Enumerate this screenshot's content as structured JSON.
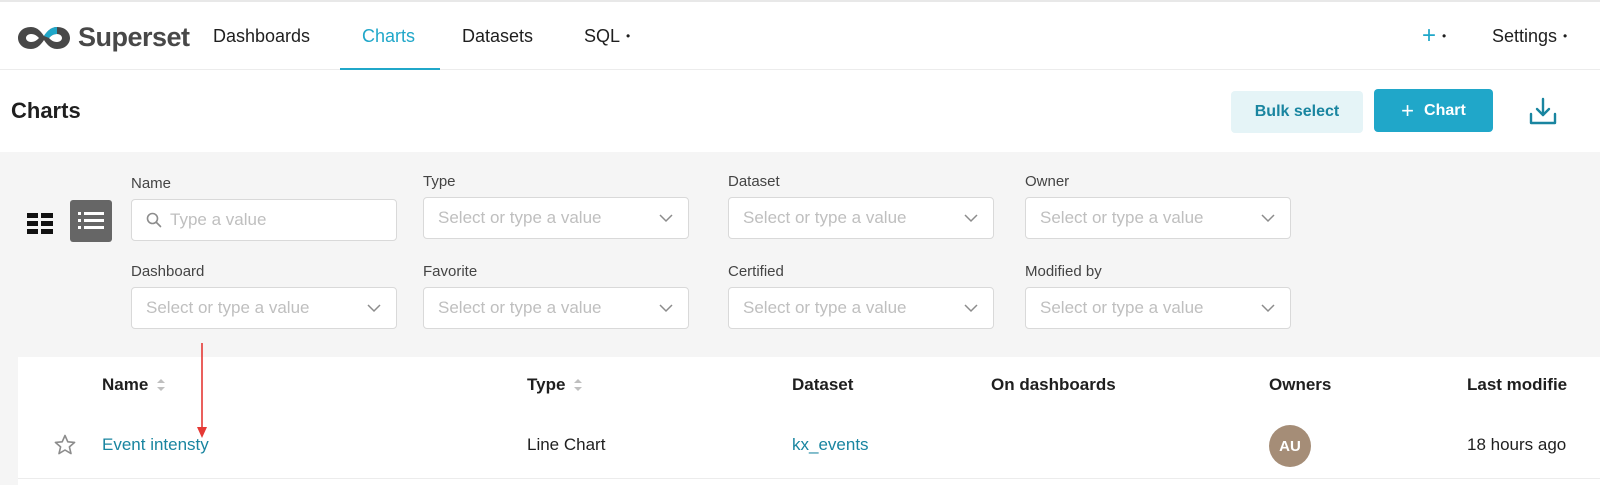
{
  "nav": {
    "brand": "Superset",
    "items": [
      {
        "label": "Dashboards"
      },
      {
        "label": "Charts"
      },
      {
        "label": "Datasets"
      },
      {
        "label": "SQL"
      }
    ],
    "settings_label": "Settings"
  },
  "header": {
    "title": "Charts",
    "bulk_select_label": "Bulk select",
    "add_chart_label": "Chart"
  },
  "filters": [
    {
      "label": "Name",
      "placeholder": "Type a value"
    },
    {
      "label": "Type",
      "placeholder": "Select or type a value"
    },
    {
      "label": "Dataset",
      "placeholder": "Select or type a value"
    },
    {
      "label": "Owner",
      "placeholder": "Select or type a value"
    },
    {
      "label": "Dashboard",
      "placeholder": "Select or type a value"
    },
    {
      "label": "Favorite",
      "placeholder": "Select or type a value"
    },
    {
      "label": "Certified",
      "placeholder": "Select or type a value"
    },
    {
      "label": "Modified by",
      "placeholder": "Select or type a value"
    }
  ],
  "table": {
    "columns": [
      "Name",
      "Type",
      "Dataset",
      "On dashboards",
      "Owners",
      "Last modifie"
    ],
    "rows": [
      {
        "name": "Event intensty",
        "type": "Line Chart",
        "dataset": "kx_events",
        "dashboards": "",
        "owner_initials": "AU",
        "last_modified": "18 hours ago"
      }
    ]
  },
  "colors": {
    "accent": "#20a7c9",
    "link": "#1985a0",
    "annotation": "#e53935"
  }
}
